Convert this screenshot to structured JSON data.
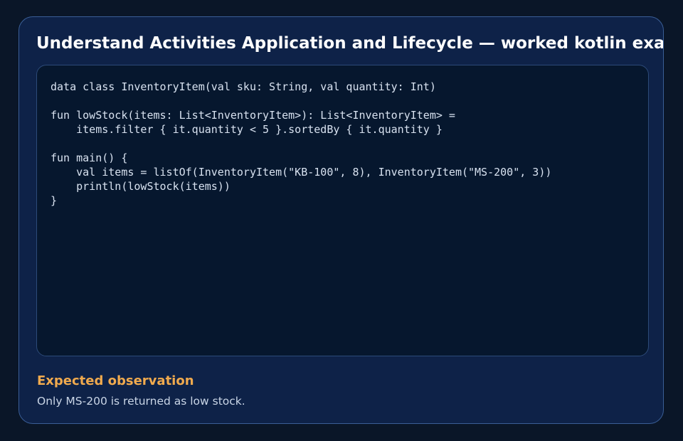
{
  "card": {
    "title": "Understand Activities Application and Lifecycle — worked kotlin example",
    "code_lines": [
      "data class InventoryItem(val sku: String, val quantity: Int)",
      "",
      "fun lowStock(items: List<InventoryItem>): List<InventoryItem> =",
      "    items.filter { it.quantity < 5 }.sortedBy { it.quantity }",
      "",
      "fun main() {",
      "    val items = listOf(InventoryItem(\"KB-100\", 8), InventoryItem(\"MS-200\", 3))",
      "    println(lowStock(items))",
      "}"
    ],
    "observation": {
      "heading": "Expected observation",
      "text": "Only MS-200 is returned as low stock."
    }
  },
  "colors": {
    "background": "#0a1628",
    "card": "#0e2248",
    "code_panel": "#06172e",
    "accent": "#f0aa4e",
    "title": "#ffffff"
  }
}
